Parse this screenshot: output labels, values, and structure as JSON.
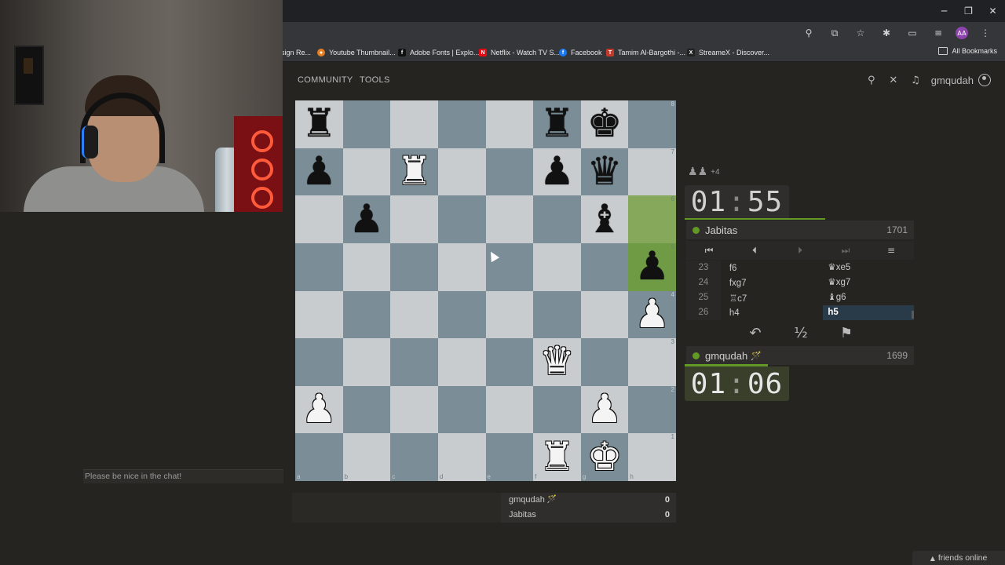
{
  "browser": {
    "window_controls": {
      "minimize": "─",
      "maximize": "❐",
      "close": "✕"
    },
    "toolbar_icons": [
      "zoom-icon",
      "install-icon",
      "star-icon",
      "extensions-icon",
      "reading-mode-icon",
      "media-icon",
      "profile-avatar",
      "menu-icon"
    ],
    "profile_initials": "AA",
    "bookmarks": [
      {
        "label": "sign Re...",
        "icon": "",
        "color": "#35363a"
      },
      {
        "label": "Youtube Thumbnail...",
        "icon": "●",
        "color": "#e67e22"
      },
      {
        "label": "Adobe Fonts | Explo...",
        "icon": "f",
        "color": "#111111"
      },
      {
        "label": "Netflix - Watch TV S...",
        "icon": "N",
        "color": "#e50914"
      },
      {
        "label": "Facebook",
        "icon": "f",
        "color": "#1877f2"
      },
      {
        "label": "Tamim Al-Bargothi -...",
        "icon": "T",
        "color": "#c0392b"
      },
      {
        "label": "StreameX - Discover...",
        "icon": "X",
        "color": "#222222"
      }
    ],
    "all_bookmarks": "All Bookmarks"
  },
  "site_nav": {
    "links": [
      "COMMUNITY",
      "TOOLS"
    ],
    "username": "gmqudah"
  },
  "chat": {
    "placeholder": "Please be nice in the chat!"
  },
  "board": {
    "files": [
      "a",
      "b",
      "c",
      "d",
      "e",
      "f",
      "g",
      "h"
    ],
    "ranks": [
      "8",
      "7",
      "6",
      "5",
      "4",
      "3",
      "2",
      "1"
    ],
    "pieces": {
      "a8": "bR",
      "f8": "bR",
      "g8": "bK",
      "a7": "bP",
      "c7": "wR",
      "f7": "bP",
      "g7": "bQ",
      "b6": "bP",
      "g6": "bB",
      "h5": "bP",
      "h4": "wP",
      "f3": "wQ",
      "a2": "wP",
      "g2": "wP",
      "f1": "wR",
      "g1": "wK"
    },
    "last_move": [
      "h6",
      "h5"
    ]
  },
  "game": {
    "captured": {
      "pieces": [
        "♟",
        "♟"
      ],
      "advantage": "+4"
    },
    "top_player": {
      "name": "Jabitas",
      "rating": "1701",
      "clock_min": "01",
      "clock_sec": "55",
      "time_fraction": 0.95
    },
    "bottom_player": {
      "name": "gmqudah",
      "badge": "🪄",
      "rating": "1699",
      "clock_min": "01",
      "clock_sec": "06",
      "time_fraction": 0.59
    },
    "nav_icons": [
      "first-icon",
      "prev-icon",
      "next-icon",
      "last-icon",
      "menu-icon"
    ],
    "moves": [
      {
        "num": "23",
        "white": "f6",
        "black": "♛xe5"
      },
      {
        "num": "24",
        "white": "fxg7",
        "black": "♛xg7"
      },
      {
        "num": "25",
        "white": "♖c7",
        "black": "♝g6"
      },
      {
        "num": "26",
        "white": "h4",
        "black": "h5"
      }
    ],
    "actions": {
      "takeback": "↶",
      "draw": "½",
      "resign": "⚑"
    }
  },
  "score_table": [
    {
      "name": "gmqudah",
      "badge": "🪄",
      "points": "0"
    },
    {
      "name": "Jabitas",
      "badge": "",
      "points": "0"
    }
  ],
  "friends": {
    "label": "friends online",
    "arrow": "▲"
  }
}
